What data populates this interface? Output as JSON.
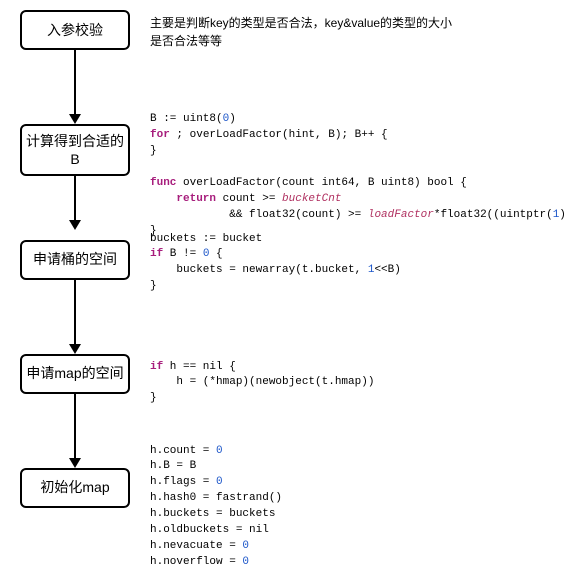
{
  "boxes": {
    "b1": "入参校验",
    "b2": "计算得到合适的B",
    "b3": "申请桶的空间",
    "b4": "申请map的空间",
    "b5": "初始化map"
  },
  "desc1_l1": "主要是判断key的类型是否合法，key&value的类型的大小",
  "desc1_l2": "是否合法等等",
  "code2": {
    "l1a": "B := uint8(",
    "l1n": "0",
    "l1b": ")",
    "l2a": "for",
    "l2b": " ; overLoadFactor(hint, B); B++ {",
    "l3": "}",
    "blank1": "",
    "l4a": "func",
    "l4b": " overLoadFactor(count int64, B uint8) bool {",
    "l5a": "    ",
    "l5b": "return",
    "l5c": " count >= ",
    "l5d": "bucketCnt",
    "l6a": "            && float32(count) >= ",
    "l6b": "loadFactor",
    "l6c": "*float32((uintptr(",
    "l6n": "1",
    "l6d": ")<<B))",
    "l7": "}"
  },
  "code3": {
    "l1": "buckets := bucket",
    "l2a": "if",
    "l2b": " B != ",
    "l2n": "0",
    "l2c": " {",
    "l3a": "    buckets = newarray(t.bucket, ",
    "l3n": "1",
    "l3b": "<<B)",
    "l4": "}"
  },
  "code4": {
    "l1a": "if",
    "l1b": " h == nil {",
    "l2": "    h = (*hmap)(newobject(t.hmap))",
    "l3": "}"
  },
  "code5": {
    "l1a": "h.count = ",
    "l1n": "0",
    "l2": "h.B = B",
    "l3a": "h.flags = ",
    "l3n": "0",
    "l4": "h.hash0 = fastrand()",
    "l5": "h.buckets = buckets",
    "l6": "h.oldbuckets = nil",
    "l7a": "h.nevacuate = ",
    "l7n": "0",
    "l8a": "h.noverflow = ",
    "l8n": "0"
  }
}
